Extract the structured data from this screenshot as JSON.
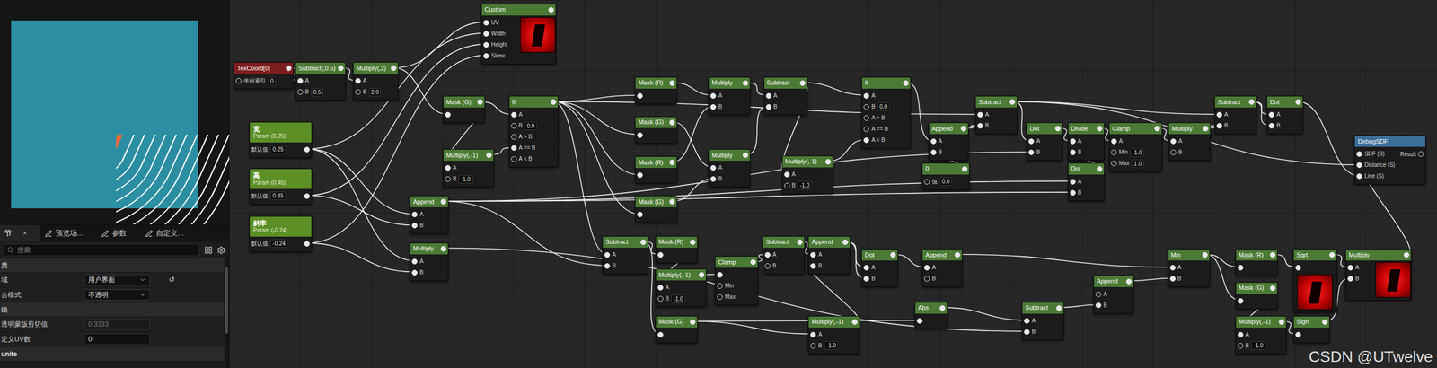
{
  "details": {
    "tabs": [
      {
        "label": "节",
        "close": "×",
        "selected": true
      },
      {
        "label": "预览场...",
        "selected": false
      },
      {
        "label": "参数",
        "selected": false
      },
      {
        "label": "自定义...",
        "selected": false
      }
    ],
    "search": {
      "placeholder": "搜索"
    },
    "rows": [
      {
        "kind": "section",
        "label": "质"
      },
      {
        "kind": "dropdown",
        "label": "域",
        "value": "用户界面",
        "reset": "↺"
      },
      {
        "kind": "dropdown",
        "label": "合模式",
        "value": "不透明"
      },
      {
        "kind": "section",
        "label": "级"
      },
      {
        "kind": "field",
        "label": "透明蒙版剪切值",
        "value": "0.3333",
        "disabled": true
      },
      {
        "kind": "field",
        "label": "定义UV数",
        "value": "0",
        "disabled": false
      },
      {
        "kind": "section",
        "label": "unite"
      }
    ]
  },
  "nodes": [
    {
      "title": "TexCoord[0]",
      "kind": "red",
      "pins": [
        {
          "label": "坐标索引",
          "value": "0"
        }
      ],
      "preview": false
    },
    {
      "title": "Subtract(,0.5)",
      "kind": "normal",
      "pins": [
        {
          "label": "A"
        },
        {
          "label": "B",
          "value": "0.5"
        }
      ],
      "preview": false
    },
    {
      "title": "Multiply(,2)",
      "kind": "normal",
      "pins": [
        {
          "label": "A"
        },
        {
          "label": "B",
          "value": "2.0"
        }
      ],
      "preview": false
    },
    {
      "title": "Custom",
      "kind": "normal",
      "pins": [
        {
          "label": "UV"
        },
        {
          "label": "Width"
        },
        {
          "label": "Height"
        },
        {
          "label": "Skew"
        }
      ],
      "preview": true
    },
    {
      "title": "宽",
      "subtitle": "Param (0.25)",
      "kind": "param",
      "pins": [
        {
          "label": "默认值",
          "value": "0.25"
        }
      ],
      "preview": false
    },
    {
      "title": "高",
      "subtitle": "Param (0.45)",
      "kind": "param",
      "pins": [
        {
          "label": "默认值",
          "value": "0.45"
        }
      ],
      "preview": false
    },
    {
      "title": "斜率",
      "subtitle": "Param (-0.24)",
      "kind": "param",
      "pins": [
        {
          "label": "默认值",
          "value": "-0.24"
        }
      ],
      "preview": false
    },
    {
      "title": "Mask (G)",
      "kind": "normal",
      "pins": [
        {
          "label": ""
        }
      ],
      "preview": false
    },
    {
      "title": "If",
      "kind": "normal",
      "pins": [
        {
          "label": "A"
        },
        {
          "label": "B",
          "value": "0.0"
        },
        {
          "label": "A > B"
        },
        {
          "label": "A == B"
        },
        {
          "label": "A < B"
        }
      ],
      "preview": false
    },
    {
      "title": "Multiply(,-1)",
      "kind": "normal",
      "pins": [
        {
          "label": "A"
        },
        {
          "label": "B",
          "value": "-1.0"
        }
      ],
      "preview": false
    },
    {
      "title": "Append",
      "kind": "normal",
      "pins": [
        {
          "label": "A"
        },
        {
          "label": "B"
        }
      ],
      "preview": false
    },
    {
      "title": "Multiply",
      "kind": "normal",
      "pins": [
        {
          "label": "A"
        },
        {
          "label": "B"
        }
      ],
      "preview": false
    },
    {
      "title": "Mask (R)",
      "kind": "normal",
      "pins": [
        {
          "label": ""
        }
      ],
      "preview": false
    },
    {
      "title": "Mask (G)",
      "kind": "normal",
      "pins": [
        {
          "label": ""
        }
      ],
      "preview": false
    },
    {
      "title": "Mask (R)",
      "kind": "normal",
      "pins": [
        {
          "label": ""
        }
      ],
      "preview": false
    },
    {
      "title": "Mask (G)",
      "kind": "normal",
      "pins": [
        {
          "label": ""
        }
      ],
      "preview": false
    },
    {
      "title": "Multiply",
      "kind": "normal",
      "pins": [
        {
          "label": "A"
        },
        {
          "label": "B"
        }
      ],
      "preview": false
    },
    {
      "title": "Multiply",
      "kind": "normal",
      "pins": [
        {
          "label": "A"
        },
        {
          "label": "B"
        }
      ],
      "preview": false
    },
    {
      "title": "Subtract",
      "kind": "normal",
      "pins": [
        {
          "label": "A"
        },
        {
          "label": "B"
        }
      ],
      "preview": false
    },
    {
      "title": "Multiply(,-1)",
      "kind": "normal",
      "pins": [
        {
          "label": "A"
        },
        {
          "label": "B",
          "value": "-1.0"
        }
      ],
      "preview": false
    },
    {
      "title": "If",
      "kind": "normal",
      "pins": [
        {
          "label": "A"
        },
        {
          "label": "B",
          "value": "0.0"
        },
        {
          "label": "A > B"
        },
        {
          "label": "A == B"
        },
        {
          "label": "A < B"
        }
      ],
      "preview": false
    },
    {
      "title": "Append",
      "kind": "normal",
      "pins": [
        {
          "label": "A"
        },
        {
          "label": "B"
        }
      ],
      "preview": false
    },
    {
      "title": "0",
      "kind": "normal",
      "pins": [
        {
          "label": "值",
          "value": "0.0"
        }
      ],
      "preview": false
    },
    {
      "title": "Subtract",
      "kind": "normal",
      "pins": [
        {
          "label": "A"
        },
        {
          "label": "B"
        }
      ],
      "preview": false
    },
    {
      "title": "Dot",
      "kind": "normal",
      "pins": [
        {
          "label": "A"
        },
        {
          "label": "B"
        }
      ],
      "preview": false
    },
    {
      "title": "Divide",
      "kind": "normal",
      "pins": [
        {
          "label": "A"
        },
        {
          "label": "B"
        }
      ],
      "preview": false
    },
    {
      "title": "Clamp",
      "kind": "normal",
      "pins": [
        {
          "label": "A"
        },
        {
          "label": "Min",
          "value": "-1.0"
        },
        {
          "label": "Max",
          "value": "1.0"
        }
      ],
      "preview": false
    },
    {
      "title": "Multiply",
      "kind": "normal",
      "pins": [
        {
          "label": "A"
        },
        {
          "label": "B"
        }
      ],
      "preview": false
    },
    {
      "title": "Dot",
      "kind": "normal",
      "pins": [
        {
          "label": "A"
        },
        {
          "label": "B"
        }
      ],
      "preview": false
    },
    {
      "title": "Subtract",
      "kind": "normal",
      "pins": [
        {
          "label": "A"
        },
        {
          "label": "B"
        }
      ],
      "preview": false
    },
    {
      "title": "Dot",
      "kind": "normal",
      "pins": [
        {
          "label": "A"
        },
        {
          "label": "B"
        }
      ],
      "preview": false
    },
    {
      "title": "DebugSDF",
      "kind": "blue",
      "output": "Result",
      "pins": [
        {
          "label": "SDF (S)"
        },
        {
          "label": "Distance (S)"
        },
        {
          "label": "Line (S)"
        }
      ],
      "preview": false
    },
    {
      "title": "Subtract",
      "kind": "normal",
      "pins": [
        {
          "label": "A"
        },
        {
          "label": "B"
        }
      ],
      "preview": false
    },
    {
      "title": "Mask (R)",
      "kind": "normal",
      "pins": [
        {
          "label": ""
        }
      ],
      "preview": false
    },
    {
      "title": "Multiply(,-1)",
      "kind": "normal",
      "pins": [
        {
          "label": "A"
        },
        {
          "label": "B",
          "value": "-1.0"
        }
      ],
      "preview": false
    },
    {
      "title": "Clamp",
      "kind": "normal",
      "pins": [
        {
          "label": ""
        },
        {
          "label": "Min"
        },
        {
          "label": "Max"
        }
      ],
      "preview": false
    },
    {
      "title": "Mask (G)",
      "kind": "normal",
      "pins": [
        {
          "label": ""
        }
      ],
      "preview": false
    },
    {
      "title": "Subtract",
      "kind": "normal",
      "pins": [
        {
          "label": "A"
        },
        {
          "label": "B"
        }
      ],
      "preview": false
    },
    {
      "title": "Append",
      "kind": "normal",
      "pins": [
        {
          "label": "A"
        },
        {
          "label": "B"
        }
      ],
      "preview": false
    },
    {
      "title": "Dot",
      "kind": "normal",
      "pins": [
        {
          "label": "A"
        },
        {
          "label": "B"
        }
      ],
      "preview": false
    },
    {
      "title": "Append",
      "kind": "normal",
      "pins": [
        {
          "label": "A"
        },
        {
          "label": "B"
        }
      ],
      "preview": false
    },
    {
      "title": "Abs",
      "kind": "normal",
      "pins": [
        {
          "label": ""
        }
      ],
      "preview": false
    },
    {
      "title": "Multiply(,-1)",
      "kind": "normal",
      "pins": [
        {
          "label": "A"
        },
        {
          "label": "B",
          "value": "-1.0"
        }
      ],
      "preview": false
    },
    {
      "title": "Subtract",
      "kind": "normal",
      "pins": [
        {
          "label": "A"
        },
        {
          "label": "B"
        }
      ],
      "preview": false
    },
    {
      "title": "Append",
      "kind": "normal",
      "pins": [
        {
          "label": "A"
        },
        {
          "label": "B"
        }
      ],
      "preview": false
    },
    {
      "title": "Min",
      "kind": "normal",
      "pins": [
        {
          "label": "A"
        },
        {
          "label": "B"
        }
      ],
      "preview": false
    },
    {
      "title": "Mask (R)",
      "kind": "normal",
      "pins": [
        {
          "label": ""
        }
      ],
      "preview": false
    },
    {
      "title": "Mask (G)",
      "kind": "normal",
      "pins": [
        {
          "label": ""
        }
      ],
      "preview": false
    },
    {
      "title": "Sqrt",
      "kind": "normal",
      "pins": [
        {
          "label": ""
        }
      ],
      "preview": true
    },
    {
      "title": "Multiply",
      "kind": "normal",
      "pins": [
        {
          "label": "A"
        },
        {
          "label": "B"
        }
      ],
      "preview": true
    },
    {
      "title": "Multiply(,-1)",
      "kind": "normal",
      "pins": [
        {
          "label": "A"
        },
        {
          "label": "B",
          "value": "-1.0"
        }
      ],
      "preview": false
    },
    {
      "title": "Sign",
      "kind": "normal",
      "pins": [
        {
          "label": ""
        }
      ],
      "preview": false
    }
  ],
  "wires": [
    [
      0,
      1,
      0
    ],
    [
      1,
      2,
      0
    ],
    [
      2,
      3,
      0
    ],
    [
      4,
      3,
      1
    ],
    [
      5,
      3,
      2
    ],
    [
      6,
      3,
      3
    ],
    [
      2,
      7,
      0
    ],
    [
      7,
      8,
      0
    ],
    [
      7,
      9,
      0
    ],
    [
      9,
      8,
      3
    ],
    [
      4,
      10,
      0
    ],
    [
      5,
      10,
      1
    ],
    [
      4,
      11,
      0
    ],
    [
      6,
      11,
      1
    ],
    [
      8,
      12,
      0
    ],
    [
      8,
      13,
      0
    ],
    [
      8,
      14,
      0
    ],
    [
      8,
      15,
      0
    ],
    [
      12,
      16,
      0
    ],
    [
      14,
      16,
      1
    ],
    [
      13,
      17,
      0
    ],
    [
      15,
      17,
      1
    ],
    [
      16,
      18,
      0
    ],
    [
      17,
      18,
      1
    ],
    [
      18,
      20,
      0
    ],
    [
      18,
      19,
      0
    ],
    [
      19,
      20,
      4
    ],
    [
      20,
      21,
      0
    ],
    [
      22,
      21,
      1
    ],
    [
      21,
      23,
      1
    ],
    [
      8,
      23,
      0
    ],
    [
      23,
      24,
      0
    ],
    [
      10,
      24,
      1
    ],
    [
      24,
      25,
      0
    ],
    [
      28,
      25,
      1
    ],
    [
      25,
      26,
      0
    ],
    [
      26,
      27,
      0
    ],
    [
      27,
      29,
      1
    ],
    [
      23,
      29,
      0
    ],
    [
      29,
      30,
      0
    ],
    [
      29,
      30,
      1
    ],
    [
      10,
      28,
      0
    ],
    [
      10,
      28,
      1
    ],
    [
      8,
      32,
      0
    ],
    [
      10,
      32,
      1
    ],
    [
      32,
      33,
      0
    ],
    [
      33,
      34,
      0
    ],
    [
      34,
      35,
      0
    ],
    [
      35,
      37,
      0
    ],
    [
      32,
      36,
      0
    ],
    [
      36,
      42,
      0
    ],
    [
      37,
      38,
      0
    ],
    [
      42,
      38,
      1
    ],
    [
      38,
      39,
      0
    ],
    [
      38,
      39,
      1
    ],
    [
      39,
      40,
      0
    ],
    [
      36,
      41,
      0
    ],
    [
      41,
      43,
      0
    ],
    [
      11,
      43,
      1
    ],
    [
      43,
      44,
      1
    ],
    [
      40,
      45,
      0
    ],
    [
      44,
      45,
      1
    ],
    [
      45,
      46,
      0
    ],
    [
      45,
      47,
      0
    ],
    [
      46,
      48,
      0
    ],
    [
      48,
      49,
      0
    ],
    [
      51,
      49,
      1
    ],
    [
      47,
      50,
      0
    ],
    [
      50,
      51,
      0
    ],
    [
      49,
      31,
      0
    ],
    [
      30,
      31,
      2
    ],
    [
      23,
      31,
      1
    ]
  ],
  "watermark": "CSDN @UTwelve"
}
